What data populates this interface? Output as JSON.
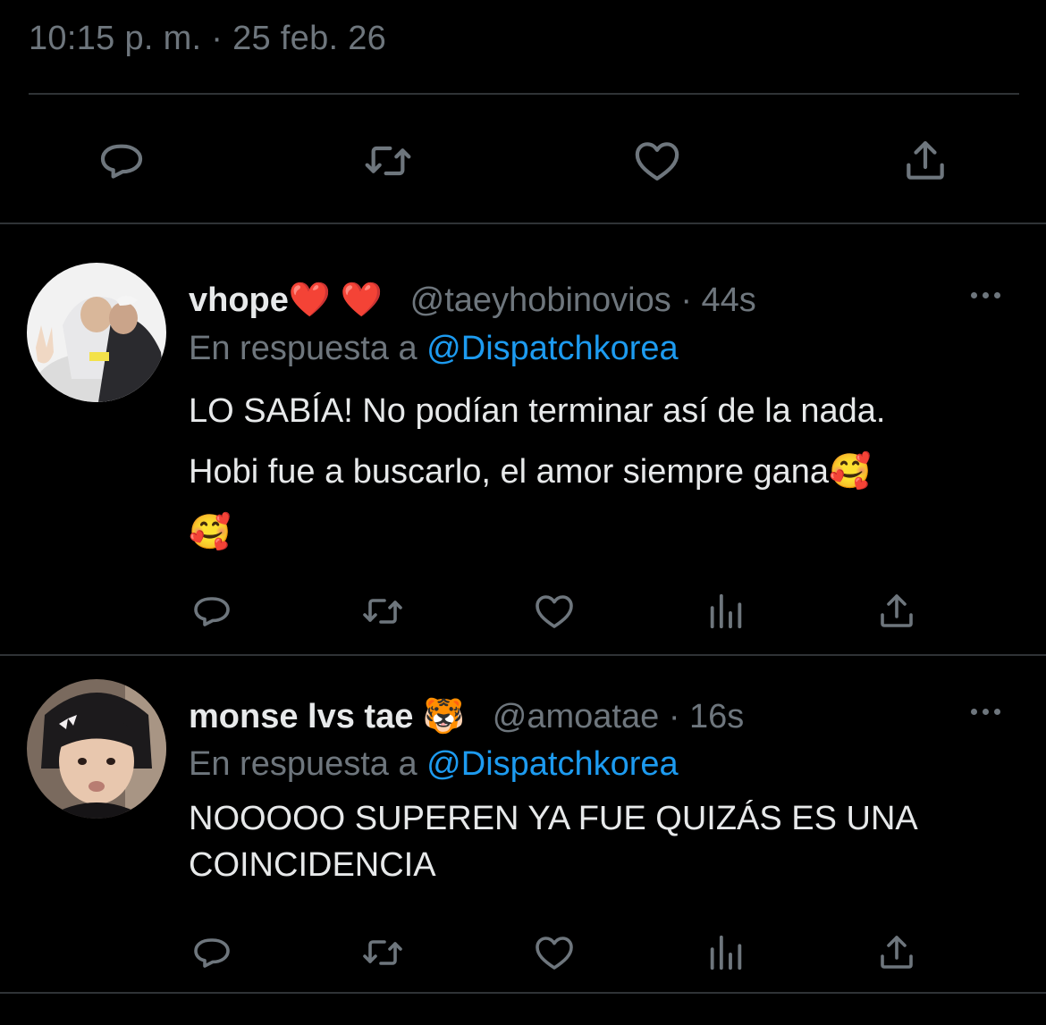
{
  "main_tweet": {
    "timestamp": "10:15 p. m. · 25 feb. 26"
  },
  "icons": [
    "reply-icon",
    "retweet-icon",
    "like-icon",
    "views-icon",
    "share-icon",
    "more-icon"
  ],
  "colors": {
    "background": "#000000",
    "text": "#e7e9ea",
    "muted": "#6e767d",
    "link": "#1d9bf0",
    "divider": "#2f3336"
  },
  "replies": [
    {
      "name": "vhope❤️ ❤️",
      "handle": "@taeyhobinovios",
      "time": "· 44s",
      "reply_prefix": "En respuesta a",
      "reply_to": "@Dispatchkorea",
      "text_lines": [
        "LO SABÍA! No podían terminar así de la nada.",
        "Hobi fue a buscarlo, el amor siempre gana🥰",
        "🥰"
      ]
    },
    {
      "name": "monse lvs tae 🐯",
      "handle": "@amoatae",
      "time": "· 16s",
      "reply_prefix": "En respuesta a",
      "reply_to": "@Dispatchkorea",
      "text_lines": [
        "NOOOOO SUPEREN YA FUE QUIZÁS ES UNA",
        "COINCIDENCIA"
      ]
    }
  ]
}
